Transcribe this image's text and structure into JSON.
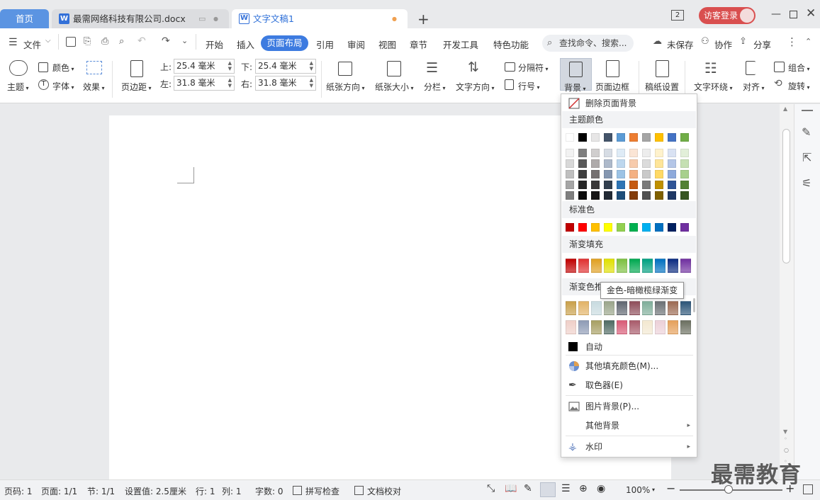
{
  "tabs": {
    "home": "首页",
    "doc1": "最需网络科技有限公司.docx",
    "doc2": "文字文稿1",
    "new_tab": "+"
  },
  "window": {
    "badge": "2",
    "login": "访客登录"
  },
  "menu": {
    "file": "文件",
    "items": [
      "开始",
      "插入",
      "页面布局",
      "引用",
      "审阅",
      "视图",
      "章节",
      "开发工具",
      "特色功能"
    ],
    "search": "查找命令、搜索...",
    "unsaved": "未保存",
    "collab": "协作",
    "share": "分享"
  },
  "ribbon": {
    "theme": "主题",
    "color": "颜色",
    "font": "字体",
    "effect": "效果",
    "margin": "页边距",
    "top_label": "上:",
    "top_value": "25.4 毫米",
    "bottom_label": "下:",
    "bottom_value": "25.4 毫米",
    "left_label": "左:",
    "left_value": "31.8 毫米",
    "right_label": "右:",
    "right_value": "31.8 毫米",
    "orientation": "纸张方向",
    "paper_size": "纸张大小",
    "columns": "分栏",
    "text_direction": "文字方向",
    "separator": "分隔符",
    "line_number": "行号",
    "background": "背景",
    "page_border": "页面边框",
    "draft_paper": "稿纸设置",
    "text_wrap": "文字环绕",
    "align": "对齐",
    "group": "组合",
    "rotate": "旋转"
  },
  "dropdown": {
    "remove_bg": "删除页面背景",
    "theme_colors_title": "主题颜色",
    "standard_colors_title": "标准色",
    "gradient_fill_title": "渐变填充",
    "gradient_scheme_title": "渐变色推",
    "auto": "自动",
    "more_fill": "其他填充颜色(M)...",
    "eyedropper": "取色器(E)",
    "picture_bg": "图片背景(P)...",
    "other_bg": "其他背景",
    "watermark": "水印",
    "tooltip": "金色-暗橄榄绿渐变",
    "theme_top": [
      "#ffffff",
      "#000000",
      "#e7e6e6",
      "#44546a",
      "#5b9bd5",
      "#ed7d31",
      "#a5a5a5",
      "#ffc000",
      "#4472c4",
      "#70ad47"
    ],
    "theme_shades": [
      [
        "#f2f2f2",
        "#7f7f7f",
        "#d0cece",
        "#d6dce4",
        "#deebf6",
        "#fbe5d5",
        "#ededed",
        "#fff2cc",
        "#d9e2f3",
        "#e2efd9"
      ],
      [
        "#d8d8d8",
        "#595959",
        "#aeaaaa",
        "#adb9ca",
        "#bdd7ee",
        "#f7cbac",
        "#dbdbdb",
        "#fee599",
        "#b4c6e7",
        "#c5e0b3"
      ],
      [
        "#bfbfbf",
        "#3f3f3f",
        "#757070",
        "#8496b0",
        "#9cc3e5",
        "#f4b183",
        "#c9c9c9",
        "#ffd965",
        "#8eaadb",
        "#a8d08d"
      ],
      [
        "#a5a5a5",
        "#262626",
        "#3a3838",
        "#323f4f",
        "#2e75b5",
        "#c55a11",
        "#7b7b7b",
        "#bf9000",
        "#2f5496",
        "#538135"
      ],
      [
        "#7f7f7f",
        "#0c0c0c",
        "#171616",
        "#222a35",
        "#1e4e79",
        "#833c0b",
        "#525252",
        "#7f6000",
        "#1f3864",
        "#375623"
      ]
    ],
    "standard": [
      "#c00000",
      "#ff0000",
      "#ffc000",
      "#ffff00",
      "#92d050",
      "#00b050",
      "#00b0f0",
      "#0070c0",
      "#002060",
      "#7030a0"
    ],
    "gradient": [
      "#c00000",
      "#e03030",
      "#e0a020",
      "#e0e000",
      "#7cc040",
      "#00a850",
      "#00a080",
      "#0070c0",
      "#0a2a80",
      "#7030a0"
    ],
    "scheme_row1": [
      "#c9a04a",
      "#e2b366",
      "#c8dbe0",
      "#9aa58a",
      "#5f6670",
      "#8e4d5a",
      "#7fae9a",
      "#6b7074",
      "#9c6a52",
      "#2c5578"
    ],
    "scheme_row2": [
      "#efcfc8",
      "#8e9bb5",
      "#a79f62",
      "#4f6a63",
      "#d85a76",
      "#a85a6a",
      "#f3e8d0",
      "#ecd0d8",
      "#e5a05a",
      "#6b6f60"
    ]
  },
  "status": {
    "page_num": "页码: 1",
    "pages": "页面: 1/1",
    "section": "节: 1/1",
    "setting": "设置值: 2.5厘米",
    "row": "行: 1",
    "col": "列: 1",
    "words": "字数: 0",
    "spell": "拼写检查",
    "proof": "文档校对",
    "zoom": "100%"
  },
  "brand_watermark": "最需教育"
}
